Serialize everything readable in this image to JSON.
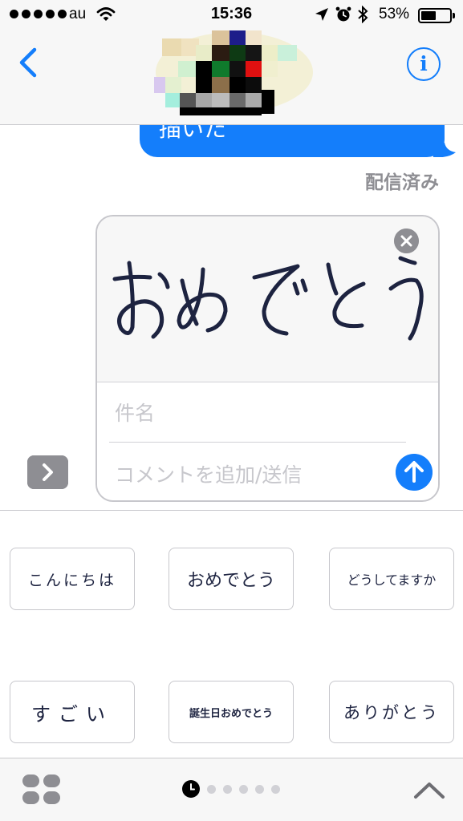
{
  "status_bar": {
    "carrier": "au",
    "time": "15:36",
    "battery_percent": "53%",
    "battery_level": 0.53,
    "signal_bars": 5
  },
  "nav": {
    "back_icon": "chevron-left-icon",
    "info_label": "i",
    "accent_color": "#147efb"
  },
  "conversation": {
    "last_message_visible_text": "描いた",
    "delivery_status": "配信済み"
  },
  "compose": {
    "handwriting_text": "おめでとう",
    "subject_placeholder": "件名",
    "comment_placeholder": "コメントを追加/送信"
  },
  "handwriting_presets": [
    {
      "text": "こんにちは"
    },
    {
      "text": "おめでとう"
    },
    {
      "text": "どうしてますか"
    },
    {
      "text": "すごい"
    },
    {
      "text": "誕生日おめでとう"
    },
    {
      "text": "ありがとう"
    }
  ],
  "bottom_bar": {
    "page_count": 6,
    "current_page": 1
  }
}
